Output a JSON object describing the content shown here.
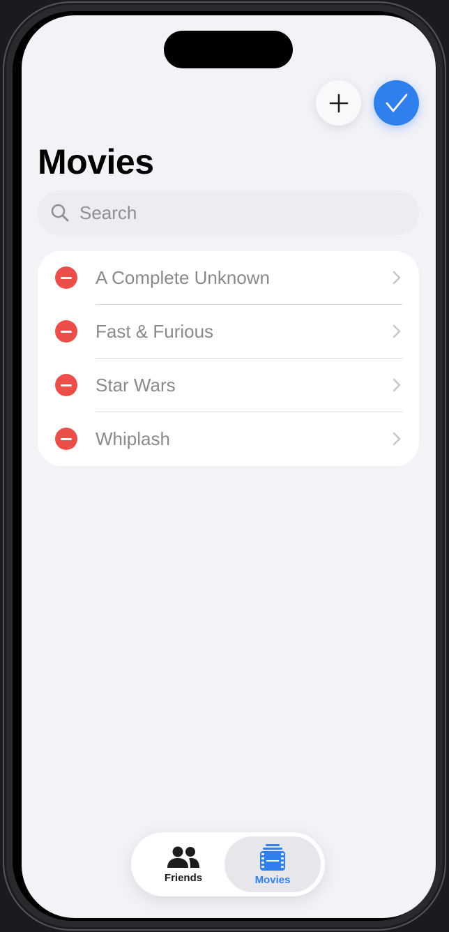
{
  "toolbar": {
    "add_icon": "plus-icon",
    "done_icon": "checkmark-icon"
  },
  "page": {
    "title": "Movies"
  },
  "search": {
    "placeholder": "Search",
    "icon": "magnifying-glass-icon"
  },
  "movies": [
    {
      "title": "A Complete Unknown"
    },
    {
      "title": "Fast & Furious"
    },
    {
      "title": "Star Wars"
    },
    {
      "title": "Whiplash"
    }
  ],
  "tabs": [
    {
      "label": "Friends",
      "icon": "person-2-icon",
      "selected": false
    },
    {
      "label": "Movies",
      "icon": "film-stack-icon",
      "selected": true
    }
  ],
  "colors": {
    "accent": "#2f80ed",
    "delete": "#ec4f4a",
    "background": "#f2f2f7"
  }
}
